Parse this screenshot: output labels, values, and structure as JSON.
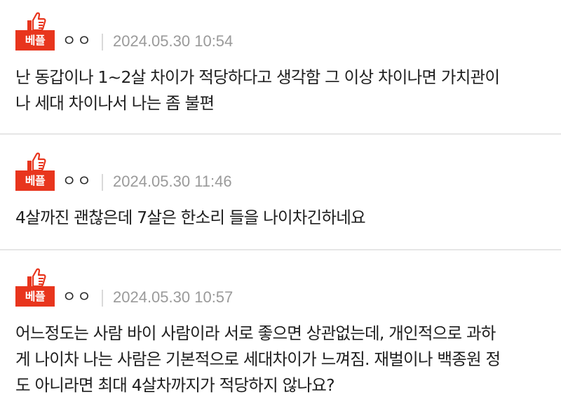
{
  "badge_label": "베플",
  "colors": {
    "best_badge": "#e8351d",
    "timestamp": "#9a9a9a",
    "divider": "#e6e6e6"
  },
  "comments": [
    {
      "author": "ㅇㅇ",
      "timestamp": "2024.05.30 10:54",
      "text": "난 동갑이나 1~2살 차이가 적당하다고 생각함 그 이상 차이나면 가치관이\n나 세대 차이나서 나는 좀 불편"
    },
    {
      "author": "ㅇㅇ",
      "timestamp": "2024.05.30 11:46",
      "text": "4살까진 괜찮은데 7살은 한소리 들을 나이차긴하네요"
    },
    {
      "author": "ㅇㅇ",
      "timestamp": "2024.05.30 10:57",
      "text": "어느정도는 사람 바이 사람이라 서로 좋으면 상관없는데, 개인적으로 과하\n게 나이차 나는 사람은 기본적으로 세대차이가 느껴짐. 재벌이나 백종원 정\n도 아니라면 최대 4살차까지가 적당하지 않나요?"
    }
  ]
}
